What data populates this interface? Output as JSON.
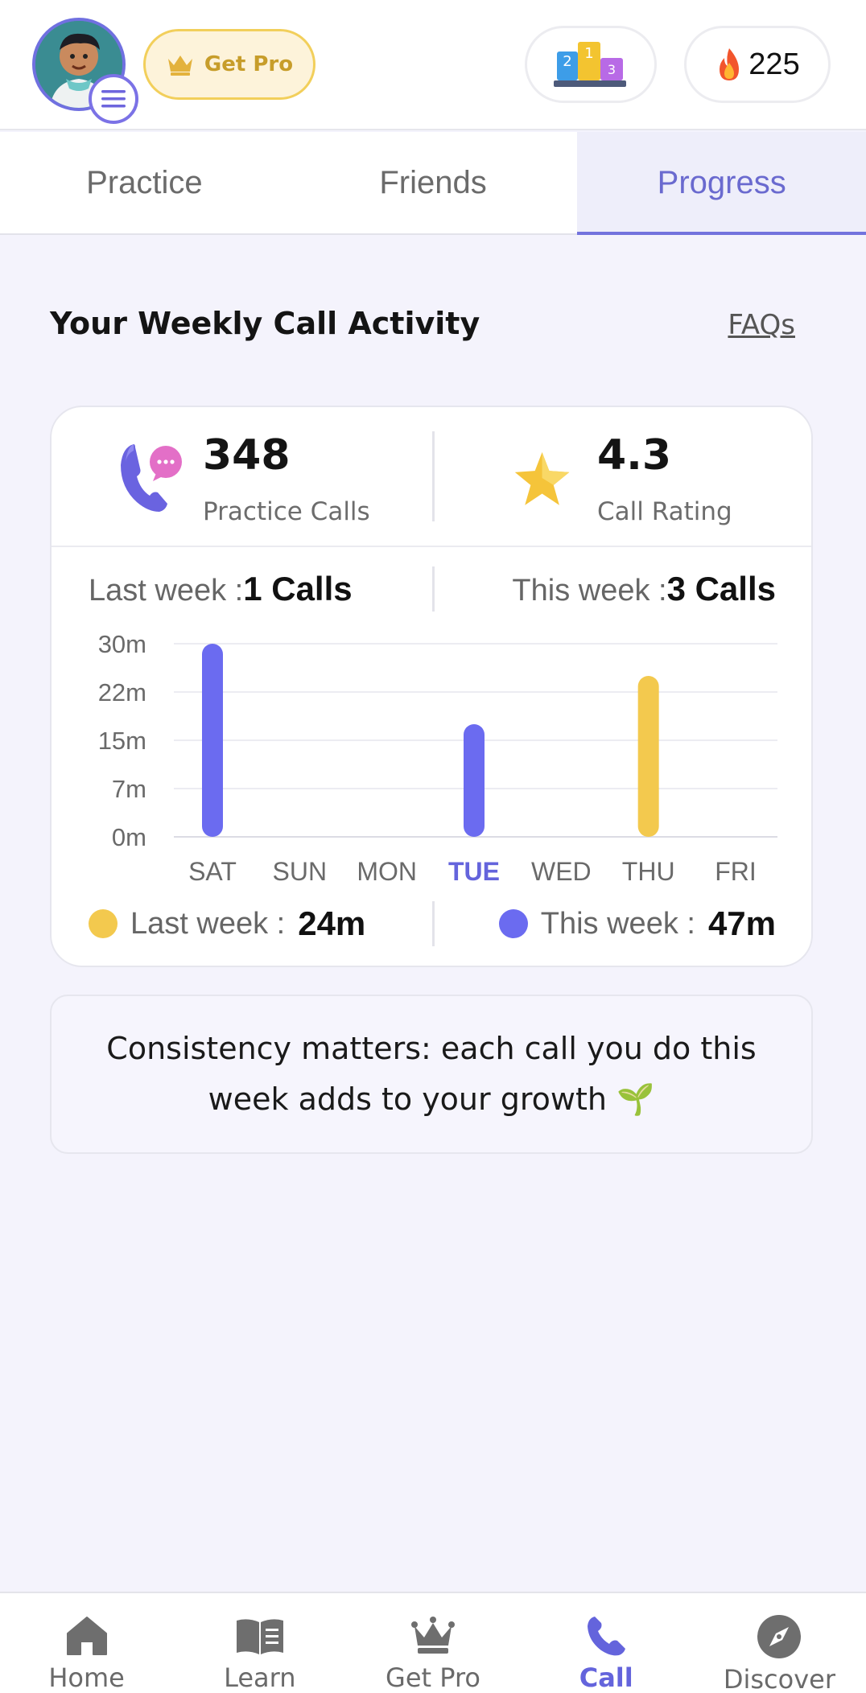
{
  "header": {
    "get_pro_label": "Get Pro",
    "leaderboard_digits": [
      "2",
      "1",
      "3"
    ],
    "streak_count": "225"
  },
  "tabs": [
    {
      "label": "Practice",
      "active": false
    },
    {
      "label": "Friends",
      "active": false
    },
    {
      "label": "Progress",
      "active": true
    }
  ],
  "section": {
    "title": "Your Weekly Call Activity",
    "faq_label": "FAQs"
  },
  "stats": {
    "calls_value": "348",
    "calls_label": "Practice Calls",
    "rating_value": "4.3",
    "rating_label": "Call Rating"
  },
  "weekly": {
    "last_week_prefix": "Last week :",
    "last_week_calls": "1 Calls",
    "this_week_prefix": "This week :",
    "this_week_calls": "3 Calls"
  },
  "chart_data": {
    "type": "bar",
    "categories": [
      "SAT",
      "SUN",
      "MON",
      "TUE",
      "WED",
      "THU",
      "FRI"
    ],
    "highlighted_category": "TUE",
    "y_tick_labels": [
      "30m",
      "22m",
      "15m",
      "7m",
      "0m"
    ],
    "y_tick_values": [
      30,
      22.5,
      15,
      7.5,
      0
    ],
    "ylim": [
      0,
      30
    ],
    "grid": true,
    "series": [
      {
        "name": "This week",
        "color": "#6b6bf0",
        "values": [
          30,
          0,
          0,
          17.5,
          0,
          0,
          0
        ]
      },
      {
        "name": "Last week",
        "color": "#f3c94e",
        "values": [
          0,
          0,
          0,
          0,
          0,
          25,
          0
        ]
      }
    ]
  },
  "legend": {
    "last_week_label": "Last week :",
    "last_week_total": "24m",
    "last_week_color": "#f3c94e",
    "this_week_label": "This week :",
    "this_week_total": "47m",
    "this_week_color": "#6b6bf0"
  },
  "tip": {
    "text": "Consistency matters: each call you do this week adds to your growth 🌱"
  },
  "bottom_nav": [
    {
      "label": "Home",
      "icon": "home-icon",
      "active": false
    },
    {
      "label": "Learn",
      "icon": "book-icon",
      "active": false
    },
    {
      "label": "Get Pro",
      "icon": "crown-icon",
      "active": false
    },
    {
      "label": "Call",
      "icon": "phone-icon",
      "active": true
    },
    {
      "label": "Discover",
      "icon": "compass-icon",
      "active": false
    }
  ],
  "colors": {
    "accent": "#6b6bf0",
    "gold": "#f3c94e",
    "background": "#f4f3fc"
  }
}
